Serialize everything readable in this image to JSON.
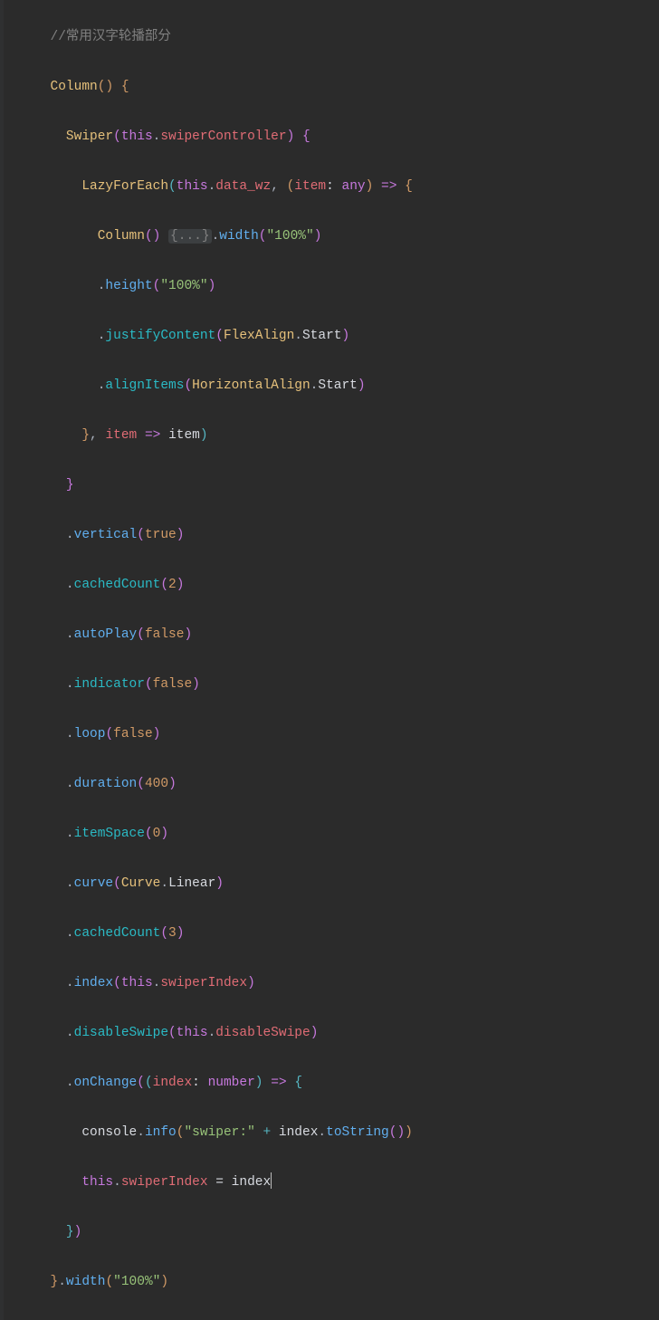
{
  "comment": "//常用汉字轮播部分",
  "tok": {
    "Column": "Column",
    "Swiper": "Swiper",
    "this": "this",
    "swiperController": "swiperController",
    "LazyForEach": "LazyForEach",
    "data_wz": "data_wz",
    "item": "item",
    "any": "any",
    "fold": "{...}",
    "width": "width",
    "s100": "\"100%\"",
    "height": "height",
    "justifyContent": "justifyContent",
    "FlexAlign": "FlexAlign",
    "Start": "Start",
    "alignItems": "alignItems",
    "HorizontalAlign": "HorizontalAlign",
    "vertical": "vertical",
    "true": "true",
    "cachedCount": "cachedCount",
    "n2": "2",
    "autoPlay": "autoPlay",
    "false": "false",
    "indicator": "indicator",
    "loop": "loop",
    "duration": "duration",
    "n400": "400",
    "itemSpace": "itemSpace",
    "n0": "0",
    "curve": "curve",
    "Curve": "Curve",
    "Linear": "Linear",
    "n3": "3",
    "index": "index",
    "swiperIndex": "swiperIndex",
    "disableSwipe": "disableSwipe",
    "onChange": "onChange",
    "number": "number",
    "console": "console",
    "info": "info",
    "swiperStr": "\"swiper:\"",
    "toString": "toString",
    "plus": "+",
    "eq": "=",
    "arrow": "=>",
    "comma": ",",
    "colon": ":"
  }
}
